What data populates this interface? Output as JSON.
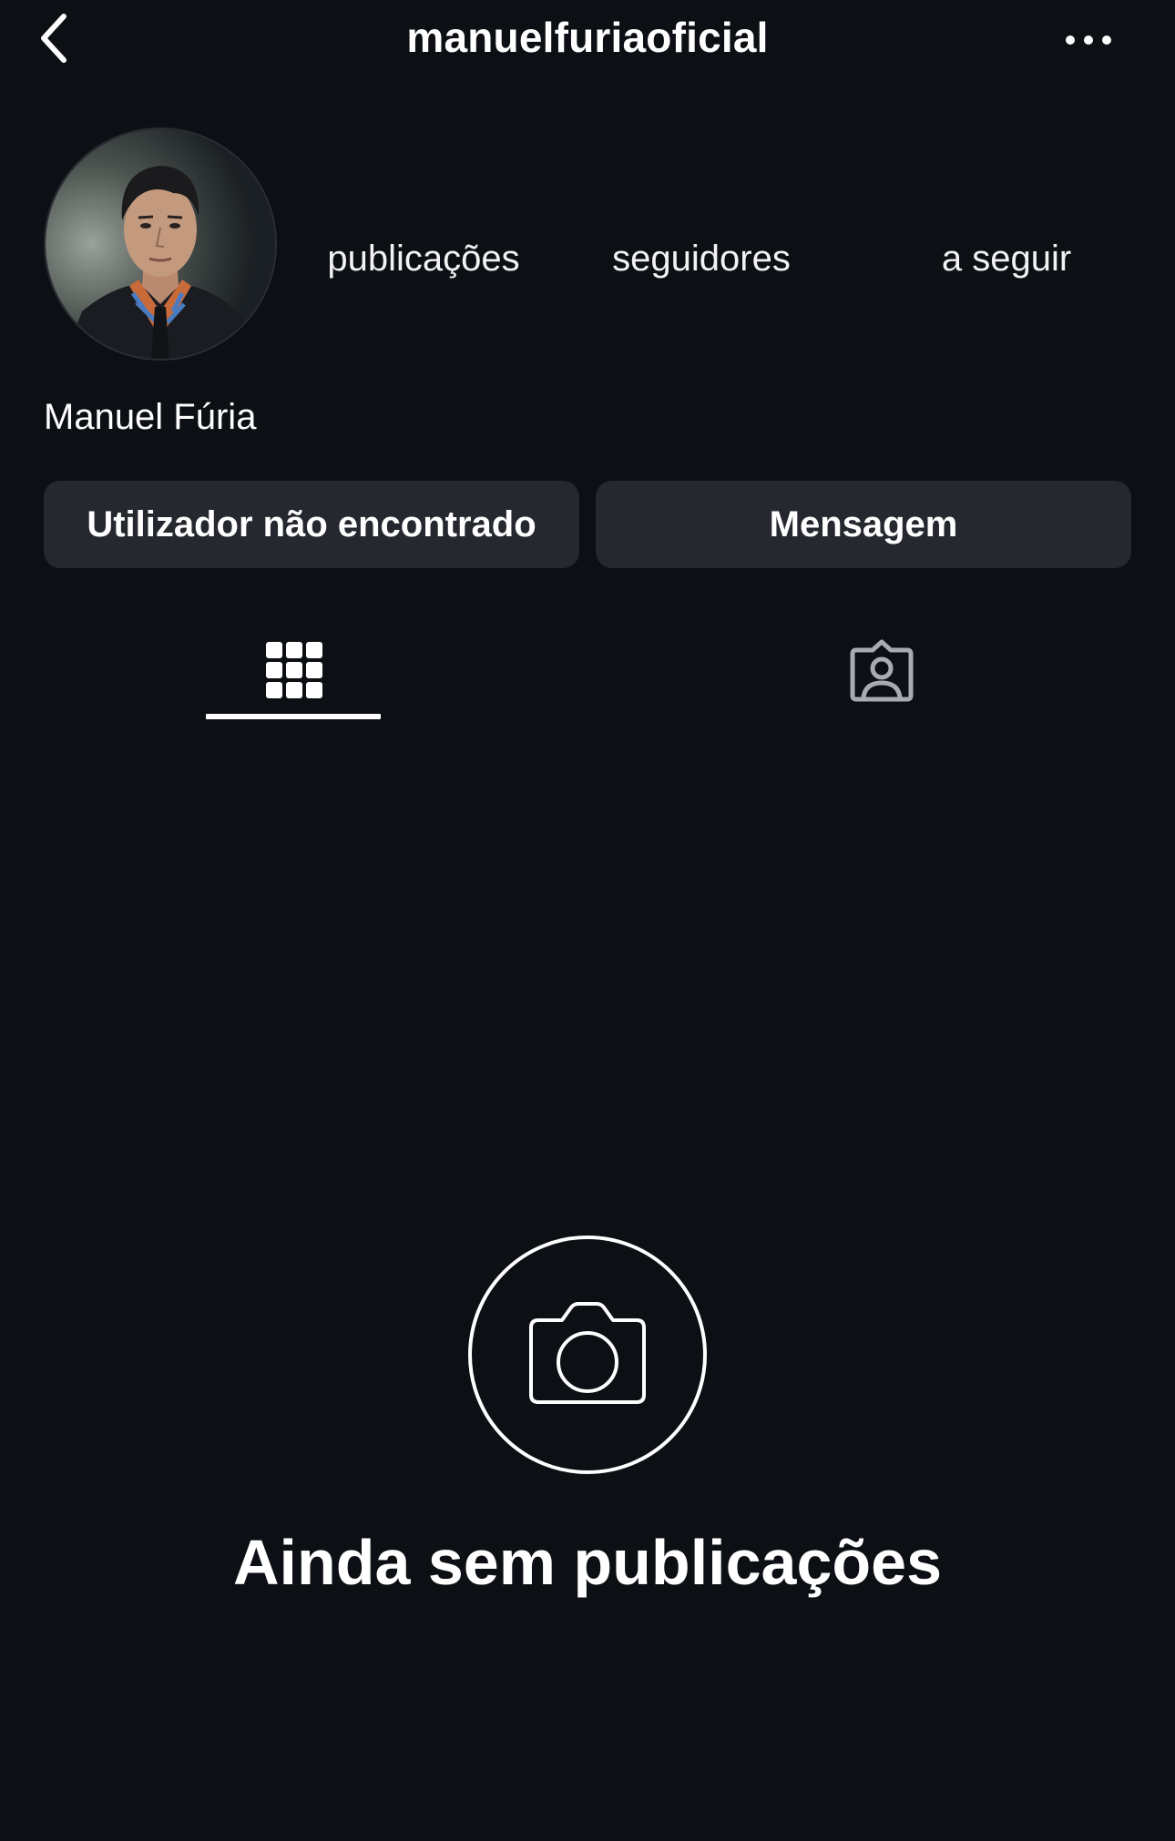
{
  "header": {
    "username": "manuelfuriaoficial",
    "back_icon": "chevron-left-icon",
    "more_icon": "more-horizontal-icon"
  },
  "profile": {
    "stats": {
      "posts_label": "publicações",
      "followers_label": "seguidores",
      "following_label": "a seguir"
    },
    "display_name": "Manuel Fúria"
  },
  "actions": {
    "follow_label": "Utilizador não encontrado",
    "message_label": "Mensagem"
  },
  "tabs": {
    "grid_icon": "grid-icon",
    "tagged_icon": "tagged-person-icon",
    "active": "grid"
  },
  "empty_state": {
    "icon": "camera-icon",
    "title": "Ainda sem publicações"
  },
  "colors": {
    "background": "#0c0f14",
    "button": "#25282e",
    "text": "#ffffff"
  }
}
